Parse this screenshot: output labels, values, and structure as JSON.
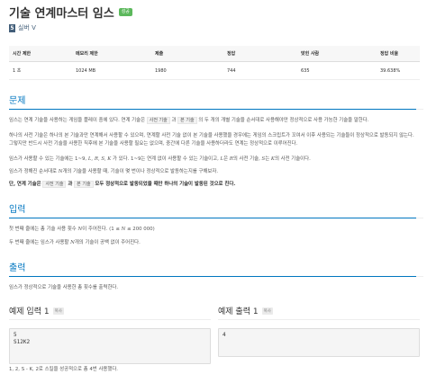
{
  "header": {
    "title": "기술 연계마스터 임스",
    "badge": "성공",
    "tier_icon": "5",
    "tier_label": "실버 V"
  },
  "info_table": {
    "headers": [
      "시간 제한",
      "메모리 제한",
      "제출",
      "정답",
      "맞힌 사람",
      "정답 비율"
    ],
    "row": [
      "1 초",
      "1024 MB",
      "1980",
      "744",
      "635",
      "39.638%"
    ]
  },
  "problem": {
    "title": "문제",
    "p1_a": "임스는 연계 기술을 사용하는 게임을 플레이 중에 있다. 연계 기술은 ",
    "p1_code1": "사전 기술",
    "p1_b": " 과 ",
    "p1_code2": "본 기술",
    "p1_c": " 의 두 개의 개별 기술을 순서대로 사용해야만 정상적으로 사용 가능한 기술을 말한다.",
    "p2": "하나의 사전 기술은 하나의 본 기술과만 연계해서 사용할 수 있으며, 연계할 사전 기술 없이 본 기술을 사용했을 경우에는 게임의 스크립트가 꼬여서 이후 사용되는 기술들이 정상적으로 발동되지 않는다. 그렇지만 반드시 사전 기술을 사용한 직후에 본 기술을 사용할 필요는 없으며, 중간에 다른 기술을 사용하더라도 연계는 정상적으로 이루어진다.",
    "p3_a": "임스가 사용할 수 있는 기술에는 1~9, ",
    "p3_m1": "L, R, S, K",
    "p3_b": " 가 있다. 1~9는 연계 없이 사용할 수 있는 기술이고, ",
    "p3_m2": "L",
    "p3_c": "은 ",
    "p3_m3": "R",
    "p3_d": "의 사전 기술, ",
    "p3_m4": "S",
    "p3_e": "는 ",
    "p3_m5": "K",
    "p3_f": "의 사전 기술이다.",
    "p4_a": "임스가 정해진 순서대로 ",
    "p4_m": "N",
    "p4_b": "개의 기술을 사용할 때, 기술이 몇 번이나 정상적으로 발동하는지를 구해보자.",
    "p5_a": "단, 연계 기술은 ",
    "p5_code1": "사전 기술",
    "p5_b": " 과 ",
    "p5_code2": "본 기술",
    "p5_c": " 모두 정상적으로 발동되었을 때만 하나의 기술이 발동된 것으로 친다."
  },
  "input": {
    "title": "입력",
    "p1_a": "첫 번째 줄에는 총 기술 사용 횟수 ",
    "p1_m": "N",
    "p1_b": "이 주어진다. (1 ≤ ",
    "p1_m2": "N",
    "p1_c": " ≤ 200 000)",
    "p2_a": "두 번째 줄에는 임스가 사용할 ",
    "p2_m": "N",
    "p2_b": "개의 기술이 공백 없이 주어진다."
  },
  "output": {
    "title": "출력",
    "p1": "임스가 정상적으로 기술을 사용한 총 횟수를 출력한다."
  },
  "examples": {
    "input_title": "예제 입력 1",
    "output_title": "예제 출력 1",
    "copy_label": "복사",
    "input_lines": [
      "5",
      "S12K2"
    ],
    "output_lines": [
      "4"
    ],
    "note": "1, 2, S - K, 2로 스킬을 성공적으로 총 4번 사용했다."
  }
}
